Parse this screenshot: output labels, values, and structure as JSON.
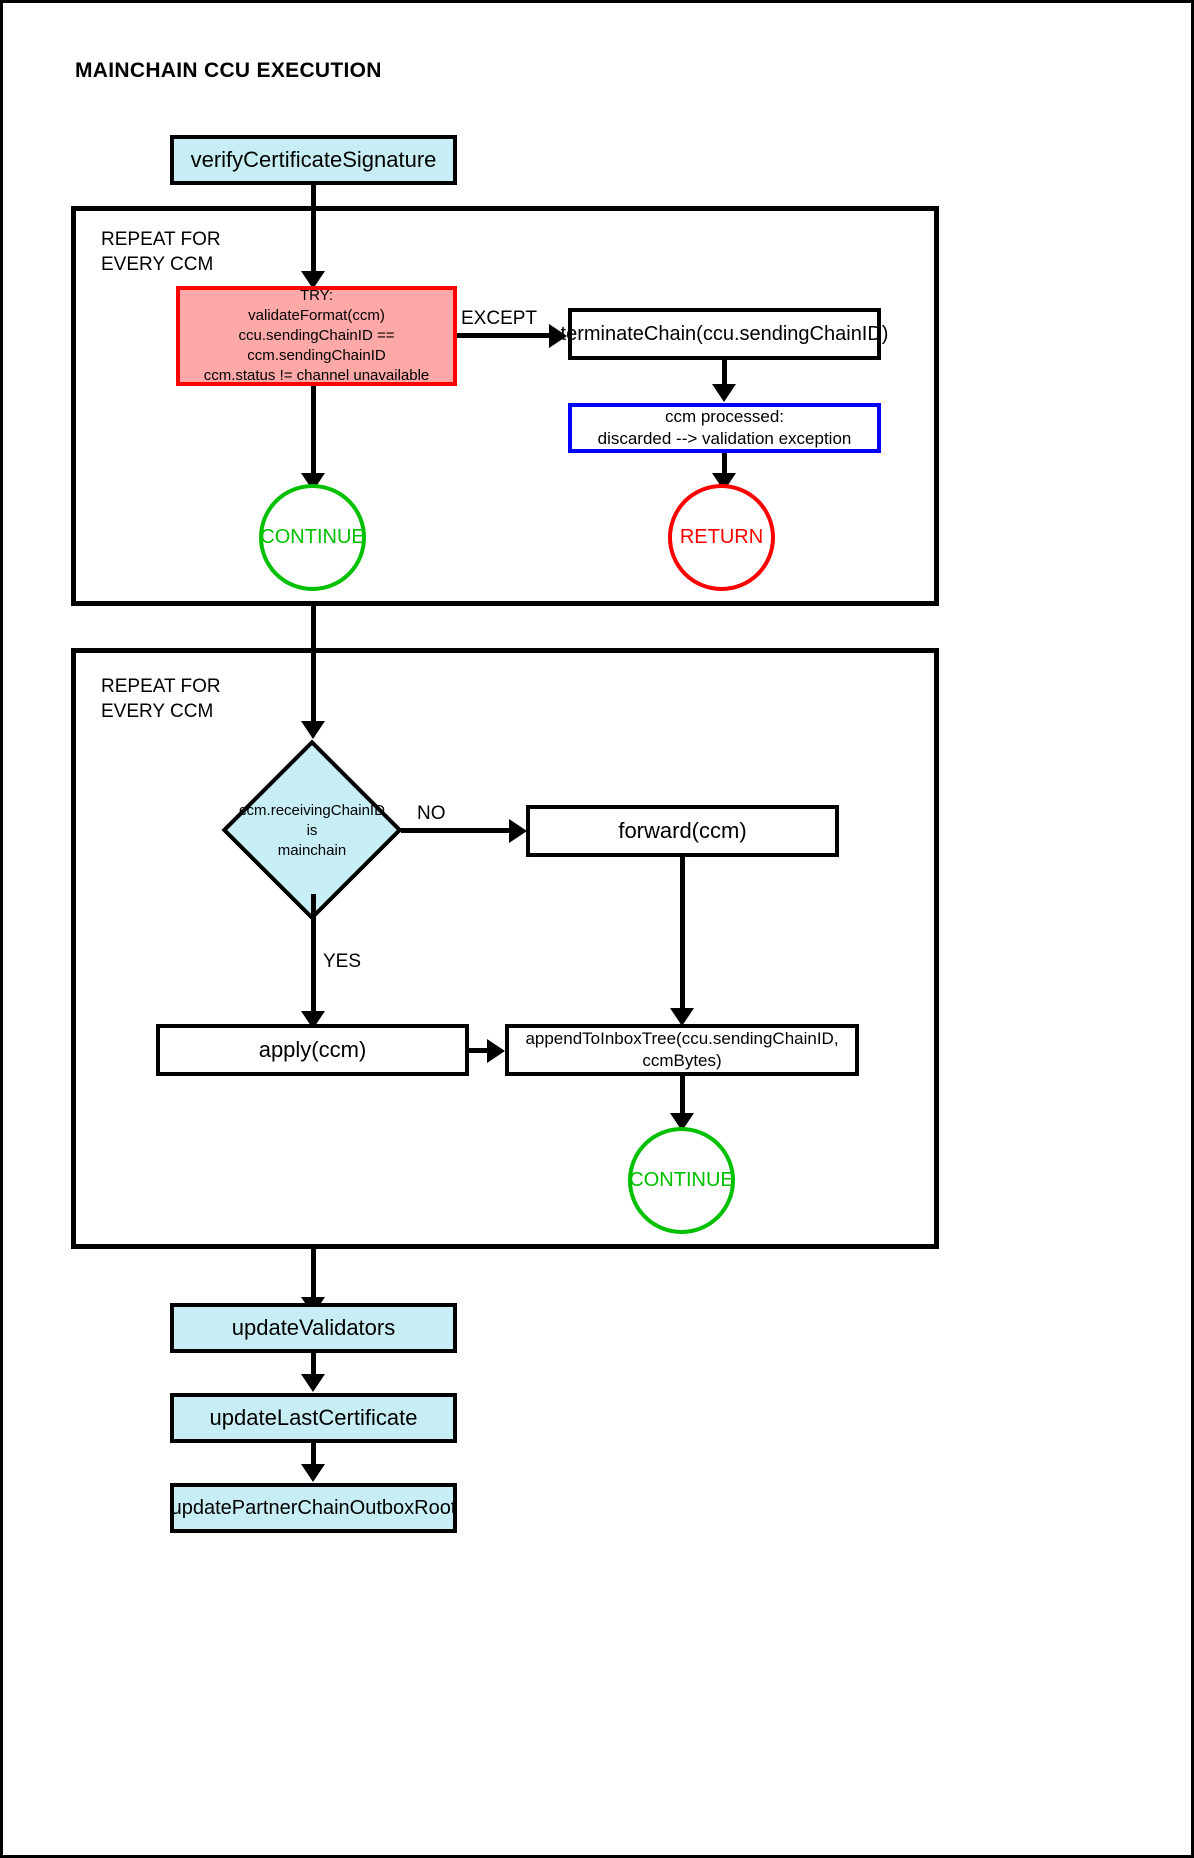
{
  "diagram": {
    "title": "MAINCHAIN CCU EXECUTION",
    "type": "flowchart"
  },
  "nodes": {
    "verify_certificate_signature": "verifyCertificateSignature",
    "try_block": "TRY:\nvalidateFormat(ccm)\nccu.sendingChainID == ccm.sendingChainID\nccm.status != channel unavailable",
    "terminate_chain": "terminateChain(ccu.sendingChainID)",
    "ccm_processed": "ccm processed:\ndiscarded --> validation exception",
    "continue_1": "CONTINUE",
    "return_1": "RETURN",
    "decision_receiving_chain": "ccm.receivingChainID\nis\nmainchain",
    "forward_ccm": "forward(ccm)",
    "apply_ccm": "apply(ccm)",
    "append_to_inbox_tree": "appendToInboxTree(ccu.sendingChainID, ccmBytes)",
    "continue_2": "CONTINUE",
    "update_validators": "updateValidators",
    "update_last_certificate": "updateLastCertificate",
    "update_partner_chain_outbox_root": "updatePartnerChainOutboxRoot"
  },
  "groups": {
    "repeat_group_1": "REPEAT FOR\nEVERY CCM",
    "repeat_group_2": "REPEAT FOR\nEVERY CCM"
  },
  "edge_labels": {
    "except": "EXCEPT",
    "no": "NO",
    "yes": "YES"
  },
  "colors": {
    "cyan_fill": "#c8eef5",
    "red_fill": "#ffa8a8",
    "red_stroke": "#ff0000",
    "blue_stroke": "#0000ff",
    "green_stroke": "#00c000",
    "black": "#000000",
    "background": "#ffffff"
  }
}
